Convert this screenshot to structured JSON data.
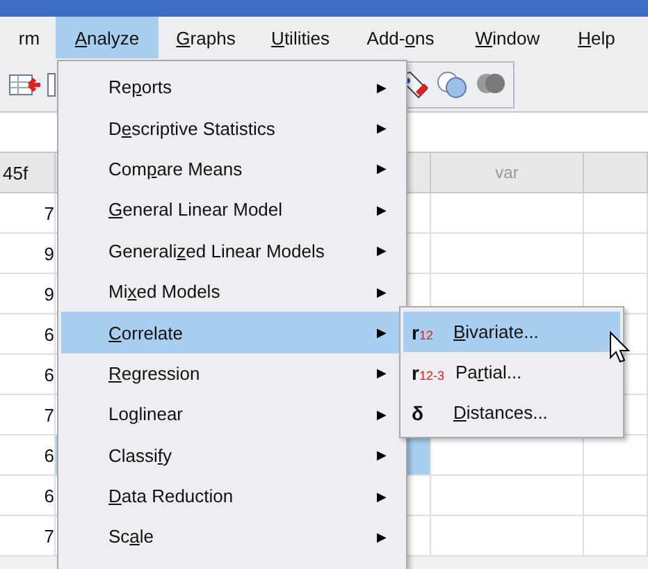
{
  "menubar": [
    {
      "label": {
        "after": "rm"
      },
      "selected": false
    },
    {
      "label": {
        "key": "A",
        "after": "nalyze"
      },
      "selected": true
    },
    {
      "label": {
        "key": "G",
        "after": "raphs"
      },
      "selected": false
    },
    {
      "label": {
        "key": "U",
        "after": "tilities"
      },
      "selected": false
    },
    {
      "label": {
        "before": "Add-",
        "key": "o",
        "after": "ns"
      },
      "selected": false
    },
    {
      "label": {
        "key": "W",
        "after": "indow"
      },
      "selected": false
    },
    {
      "label": {
        "key": "H",
        "after": "elp"
      },
      "selected": false
    }
  ],
  "grid": {
    "columns": [
      "45f",
      null,
      "var",
      null
    ],
    "rows": [
      {
        "value": "7",
        "selected": false
      },
      {
        "value": "9",
        "selected": false
      },
      {
        "value": "9",
        "selected": false
      },
      {
        "value": "6",
        "selected": false
      },
      {
        "value": "6",
        "selected": false
      },
      {
        "value": "7",
        "selected": false
      },
      {
        "value": "6",
        "selected": true
      },
      {
        "value": "6",
        "selected": false
      },
      {
        "value": "7",
        "selected": false
      }
    ]
  },
  "menu": [
    {
      "label": {
        "before": "Re",
        "key": "p",
        "after": "orts"
      },
      "selected": false
    },
    {
      "label": {
        "before": "D",
        "key": "e",
        "after": "scriptive Statistics"
      },
      "selected": false
    },
    {
      "label": {
        "before": "Com",
        "key": "p",
        "after": "are Means"
      },
      "selected": false
    },
    {
      "label": {
        "key": "G",
        "after": "eneral Linear Model"
      },
      "selected": false
    },
    {
      "label": {
        "before": "Generali",
        "key": "z",
        "after": "ed Linear Models"
      },
      "selected": false
    },
    {
      "label": {
        "before": "Mi",
        "key": "x",
        "after": "ed Models"
      },
      "selected": false
    },
    {
      "label": {
        "key": "C",
        "after": "orrelate"
      },
      "selected": true
    },
    {
      "label": {
        "key": "R",
        "after": "egression"
      },
      "selected": false
    },
    {
      "label": {
        "before": "Lo",
        "key": "g",
        "after": "linear"
      },
      "selected": false
    },
    {
      "label": {
        "before": "Classi",
        "key": "f",
        "after": "y"
      },
      "selected": false
    },
    {
      "label": {
        "key": "D",
        "after": "ata Reduction"
      },
      "selected": false
    },
    {
      "label": {
        "before": "Sc",
        "key": "a",
        "after": "le"
      },
      "selected": false
    }
  ],
  "submenu": [
    {
      "kind": "r12",
      "icon_main": "r",
      "icon_sub": "12",
      "label": {
        "key": "B",
        "after": "ivariate..."
      },
      "selected": true
    },
    {
      "kind": "r12",
      "icon_main": "r",
      "icon_sub": "12-3",
      "label": {
        "before": "Pa",
        "key": "r",
        "after": "tial..."
      },
      "selected": false
    },
    {
      "kind": "delta",
      "icon_main": "δ",
      "label": {
        "key": "D",
        "after": "istances..."
      },
      "selected": false
    }
  ],
  "arrow": "▶"
}
